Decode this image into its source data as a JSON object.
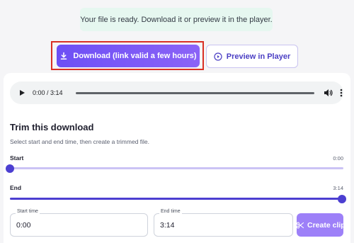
{
  "notice": {
    "text": "Your file is ready. Download it or preview it in the player."
  },
  "actions": {
    "download_label": "Download (link valid a few hours)",
    "preview_label": "Preview in Player",
    "download_icon": "download-icon",
    "preview_icon": "play-circle-icon"
  },
  "player": {
    "time": "0:00 / 3:14",
    "progress": 0,
    "icons": [
      "play-icon",
      "volume-icon",
      "more-vert-icon"
    ]
  },
  "trim": {
    "title": "Trim this download",
    "description": "Select start and end time, then create a trimmed file.",
    "start": {
      "label": "Start",
      "value_text": "0:00",
      "fraction": 0
    },
    "end": {
      "label": "End",
      "value_text": "3:14",
      "fraction": 1
    },
    "start_field": {
      "label": "Start time",
      "value": "0:00"
    },
    "end_field": {
      "label": "End time",
      "value": "3:14"
    },
    "create_label": "Create clip",
    "create_icon": "scissors-icon"
  },
  "colors": {
    "accent": "#6d4ff5",
    "accent_light": "#9d80f8",
    "thumb": "#4c3fd1",
    "highlight_border": "#d93025",
    "notice_bg": "#e6f7f0"
  }
}
